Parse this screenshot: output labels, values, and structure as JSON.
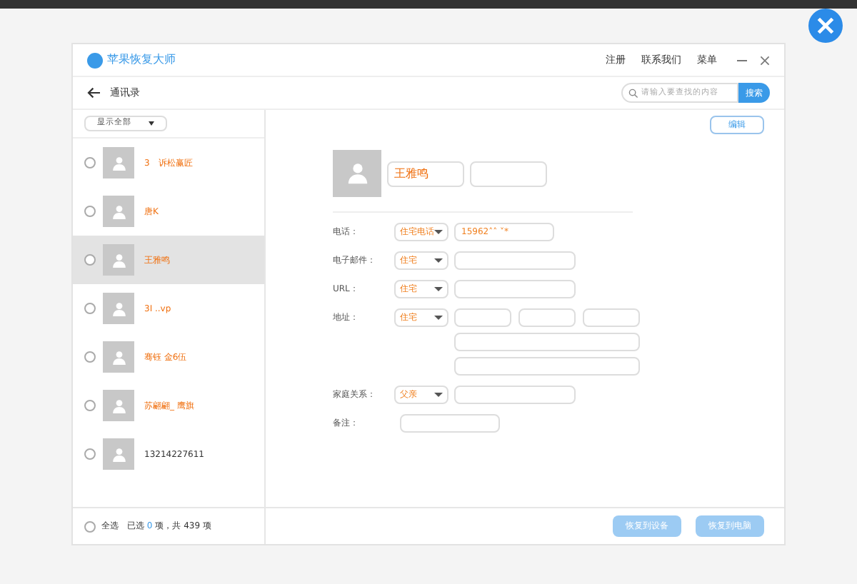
{
  "window": {
    "title": "苹果恢复大师",
    "menu": [
      "注册",
      "联系我们",
      "菜单"
    ]
  },
  "toolbar": {
    "title": "通讯录",
    "search": {
      "placeholder": "请输入要查找的内容"
    },
    "search_button": "搜索"
  },
  "filter": "显示全部",
  "contacts": [
    {
      "name": "3　诉松赢匠",
      "selected": false,
      "highlight": true
    },
    {
      "name": "唐K",
      "selected": false,
      "highlight": true
    },
    {
      "name": "王雅鸣",
      "selected": true,
      "highlight": true
    },
    {
      "name": "3I ..vp",
      "selected": false,
      "highlight": true
    },
    {
      "name": "骞钰 金6伍",
      "selected": false,
      "highlight": true
    },
    {
      "name": "苏翩翩_ 鹰旗",
      "selected": false,
      "highlight": true
    },
    {
      "name": "13214227611",
      "selected": false,
      "highlight": false
    }
  ],
  "footer": {
    "select_all": "全选",
    "select_all_checked": false,
    "selected_label": "已选",
    "count": "0",
    "total": "项，共 439 项"
  },
  "detail": {
    "edit": "编辑",
    "first_name": "王雅鸣",
    "fields": [
      {
        "label": "电话：",
        "type": "住宅电话",
        "value": "15962˄˄ ˅*"
      },
      {
        "label": "电子邮件：",
        "type": "住宅"
      },
      {
        "label": "URL：",
        "type": "住宅"
      },
      {
        "label": "地址：",
        "type": "住宅",
        "kind": "address"
      },
      {
        "label": "家庭关系：",
        "type": "父亲"
      },
      {
        "label": "备注："
      }
    ]
  },
  "actions": [
    "恢复到设备",
    "恢复到电脑"
  ]
}
